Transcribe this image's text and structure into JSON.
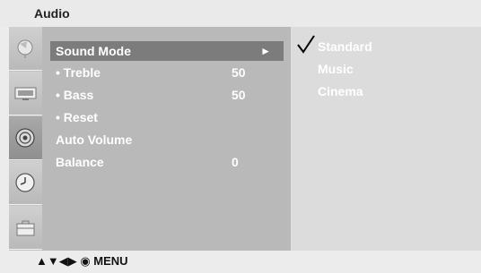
{
  "title": "Audio",
  "sidebar": {
    "icons": [
      {
        "name": "station-icon"
      },
      {
        "name": "picture-icon"
      },
      {
        "name": "audio-speaker-icon"
      },
      {
        "name": "time-clock-icon"
      },
      {
        "name": "special-toolbox-icon"
      }
    ]
  },
  "menu": {
    "items": [
      {
        "label": "Sound Mode",
        "value": "",
        "arrow": "►"
      },
      {
        "label": "• Treble",
        "value": "50"
      },
      {
        "label": "• Bass",
        "value": "50"
      },
      {
        "label": "• Reset",
        "value": ""
      },
      {
        "label": "Auto Volume",
        "value": ""
      },
      {
        "label": "Balance",
        "value": "0"
      }
    ]
  },
  "options": {
    "items": [
      {
        "label": "Standard"
      },
      {
        "label": "Music"
      },
      {
        "label": "Cinema"
      }
    ]
  },
  "help": {
    "keys": "▲▼◀▶ ◉ MENU"
  }
}
